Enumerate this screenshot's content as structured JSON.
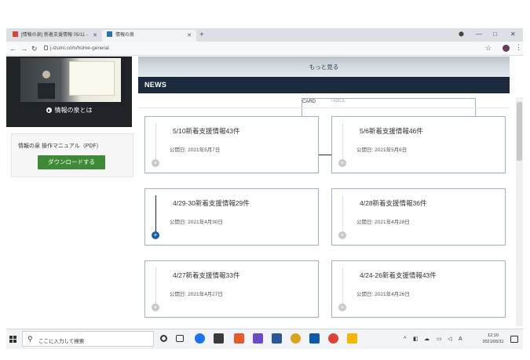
{
  "browser": {
    "tabs": [
      {
        "label": "[情報の泉] 新着支援情報 05/11 -",
        "active": false
      },
      {
        "label": "情報の泉",
        "active": true
      }
    ],
    "new_tab_label": "+",
    "url": "j-izumi.com/home-general",
    "window_controls": [
      "—",
      "□",
      "✕"
    ]
  },
  "sidebar": {
    "video_caption": "情報の泉とは",
    "manual_label": "情報の泉 操作マニュアル（PDF）",
    "download_label": "ダウンロードする"
  },
  "main": {
    "more_label": "もっと見る",
    "news_title": "NEWS",
    "view_toggle": {
      "card": "CARD",
      "table": "TABLE",
      "selected": "CARD"
    },
    "cards": [
      {
        "title": "5/10新着支援情報43件",
        "date": "公開日: 2021年5月7日",
        "active": false
      },
      {
        "title": "5/6新着支援情報46件",
        "date": "公開日: 2021年5月6日",
        "active": false
      },
      {
        "title": "4/29-30新着支援情報29件",
        "date": "公開日: 2021年4月30日",
        "active": true
      },
      {
        "title": "4/28新着支援情報36件",
        "date": "公開日: 2021年4月28日",
        "active": false
      },
      {
        "title": "4/27新着支援情報33件",
        "date": "公開日: 2021年4月27日",
        "active": false
      },
      {
        "title": "4/24-26新着支援情報43件",
        "date": "公開日: 2021年4月26日",
        "active": false
      }
    ]
  },
  "taskbar": {
    "search_placeholder": "ここに入力して検索",
    "clock_time": "12:10",
    "clock_date": "2021/05/11"
  },
  "colors": {
    "navy": "#1b2a3d",
    "download_green": "#3f8a37",
    "active_dot": "#1b5fa8"
  }
}
